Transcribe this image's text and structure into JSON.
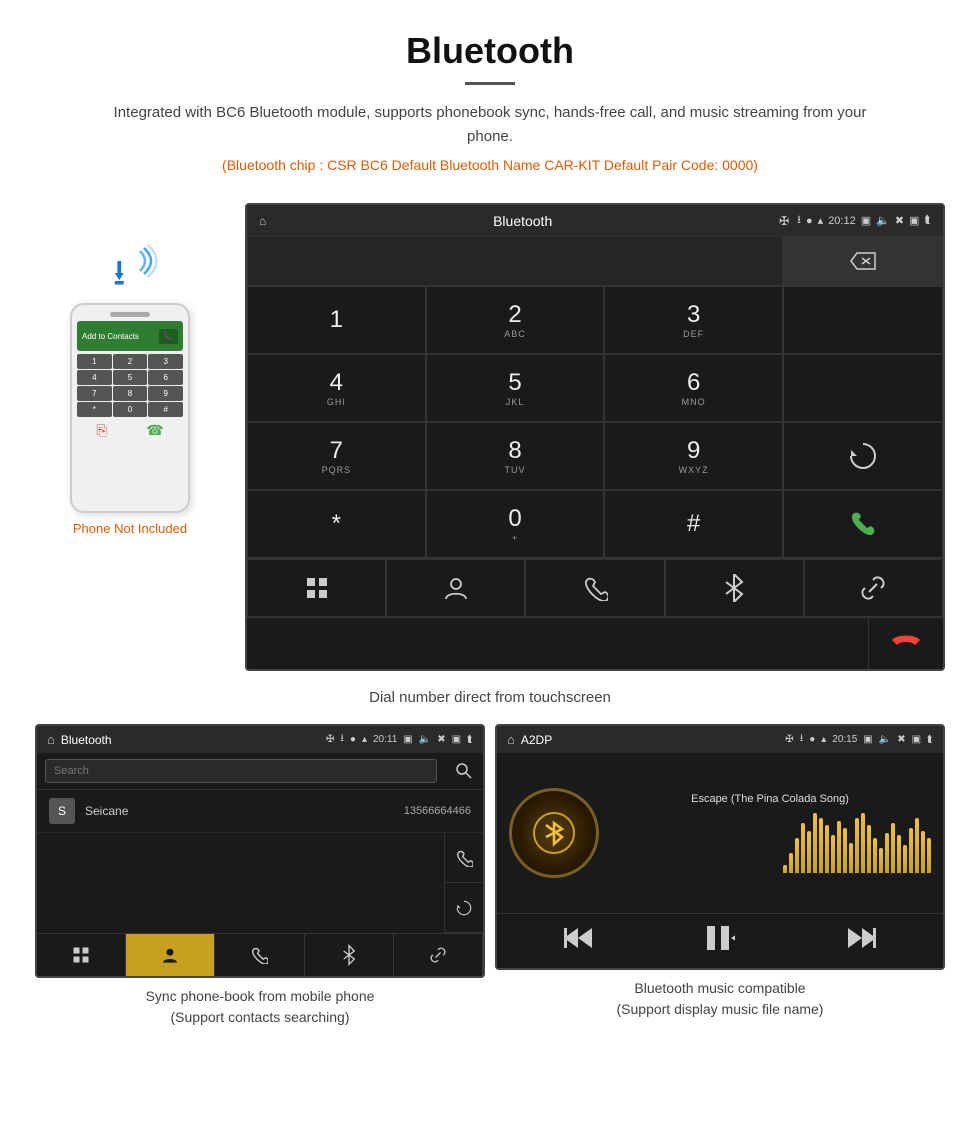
{
  "header": {
    "title": "Bluetooth",
    "description": "Integrated with BC6 Bluetooth module, supports phonebook sync, hands-free call, and music streaming from your phone.",
    "specs": "(Bluetooth chip : CSR BC6    Default Bluetooth Name CAR-KIT    Default Pair Code: 0000)"
  },
  "phone_label": "Phone Not Included",
  "dialpad_screen": {
    "status_title": "Bluetooth",
    "status_time": "20:12",
    "keys": [
      {
        "num": "1",
        "sub": ""
      },
      {
        "num": "2",
        "sub": "ABC"
      },
      {
        "num": "3",
        "sub": "DEF"
      },
      {
        "num": "4",
        "sub": "GHI"
      },
      {
        "num": "5",
        "sub": "JKL"
      },
      {
        "num": "6",
        "sub": "MNO"
      },
      {
        "num": "7",
        "sub": "PQRS"
      },
      {
        "num": "8",
        "sub": "TUV"
      },
      {
        "num": "9",
        "sub": "WXYZ"
      },
      {
        "num": "*",
        "sub": ""
      },
      {
        "num": "0",
        "sub": "+"
      },
      {
        "num": "#",
        "sub": ""
      }
    ]
  },
  "dial_caption": "Dial number direct from touchscreen",
  "phonebook_screen": {
    "status_title": "Bluetooth",
    "status_time": "20:11",
    "search_placeholder": "Search",
    "contact": {
      "initial": "S",
      "name": "Seicane",
      "number": "13566664466"
    }
  },
  "phonebook_caption_line1": "Sync phone-book from mobile phone",
  "phonebook_caption_line2": "(Support contacts searching)",
  "music_screen": {
    "status_title": "A2DP",
    "status_time": "20:15",
    "song_name": "Escape (The Pina Colada Song)"
  },
  "music_caption_line1": "Bluetooth music compatible",
  "music_caption_line2": "(Support display music file name)",
  "eq_bars": [
    8,
    20,
    35,
    50,
    42,
    60,
    55,
    48,
    38,
    52,
    45,
    30,
    55,
    60,
    48,
    35,
    25,
    40,
    50,
    38,
    28,
    45,
    55,
    42,
    35
  ]
}
